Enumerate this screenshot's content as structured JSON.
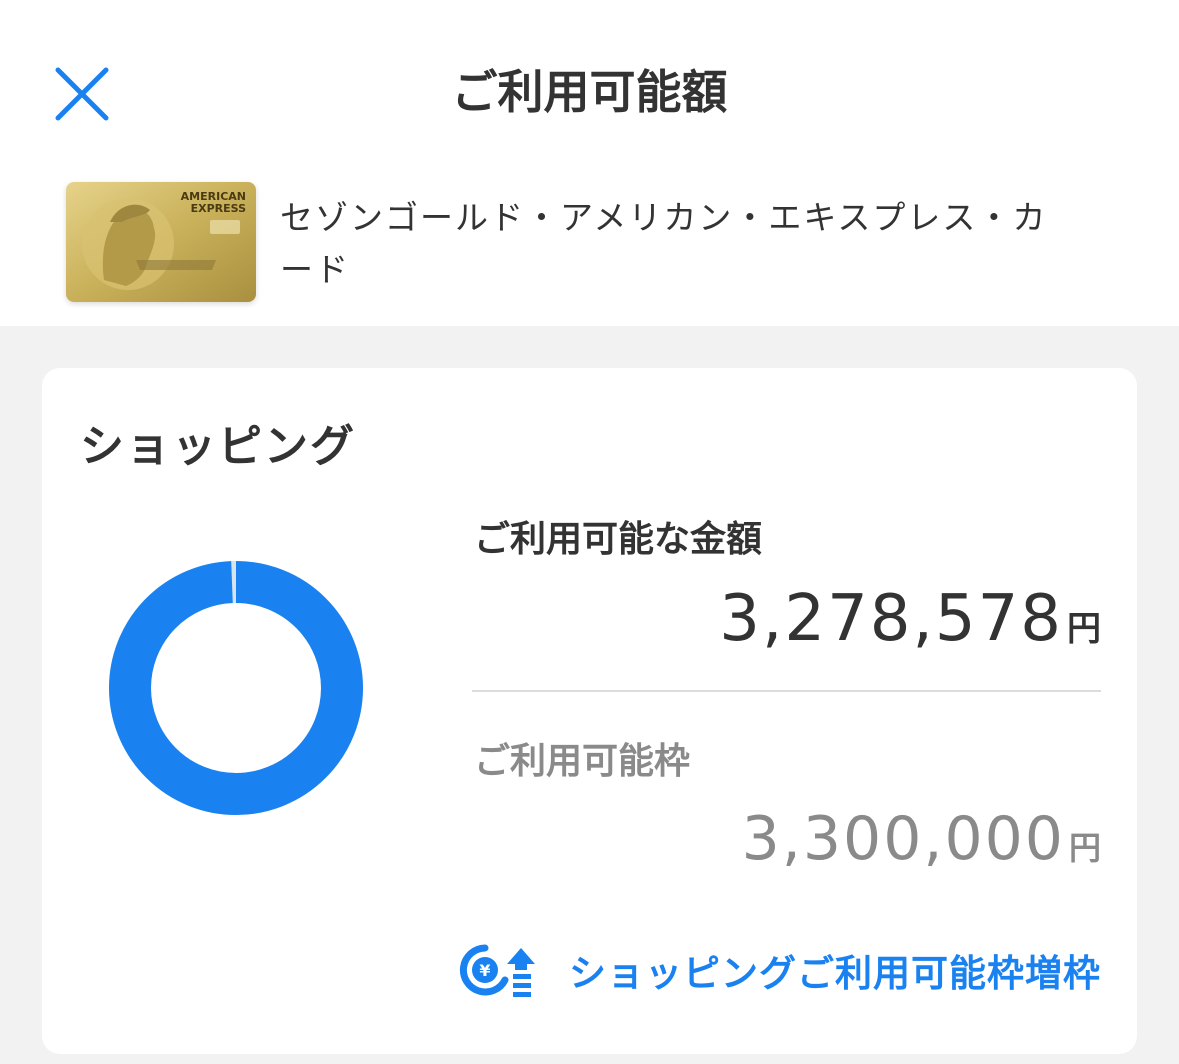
{
  "header": {
    "title": "ご利用可能額",
    "card_name": "セゾンゴールド・アメリカン・エキスプレス・カード",
    "card_logo_text": [
      "AMERICAN",
      "EXPRESS"
    ]
  },
  "shopping": {
    "section_title": "ショッピング",
    "available_label": "ご利用可能な金額",
    "available_amount": "3,278,578",
    "available_unit": "円",
    "limit_label": "ご利用可能枠",
    "limit_amount": "3,300,000",
    "limit_unit": "円",
    "increase_link": "ショッピングご利用可能枠増枠",
    "donut": {
      "available_fraction": 0.9935,
      "available_color": "#1a82f0",
      "used_color": "#d7e4f0"
    }
  },
  "colors": {
    "accent": "#1a82f0",
    "background": "#f2f2f2",
    "text": "#333333",
    "muted_text": "#8a8a8a"
  },
  "icons": {
    "close": "close-icon",
    "card": "card-thumbnail",
    "increase": "yen-increase-icon"
  }
}
